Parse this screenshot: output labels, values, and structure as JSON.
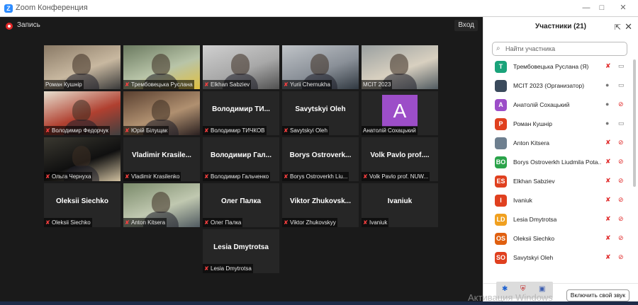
{
  "window": {
    "title": "Zoom Конференция",
    "controls": [
      "—",
      "□",
      "✕"
    ]
  },
  "stage": {
    "recording_label": "Запись",
    "exit_label": "Вход"
  },
  "tiles": [
    {
      "kind": "video",
      "label": "Роман Кушнір",
      "muted": false,
      "active": false
    },
    {
      "kind": "video",
      "label": "Трембовецька Руслана",
      "muted": true,
      "active": false
    },
    {
      "kind": "video",
      "label": "Elkhan Sabziev",
      "muted": true,
      "active": false
    },
    {
      "kind": "video",
      "label": "Yurii Chernukha",
      "muted": true,
      "active": false
    },
    {
      "kind": "video",
      "label": "MCIT 2023",
      "muted": false,
      "active": true
    },
    {
      "kind": "video",
      "label": "Володимир Федорчук",
      "muted": true,
      "active": false
    },
    {
      "kind": "video",
      "label": "Юрій Білущак",
      "muted": true,
      "active": false
    },
    {
      "kind": "name",
      "name": "Володимир ТИ...",
      "label": "Володимир ТИЧКОВ",
      "muted": true,
      "active": false
    },
    {
      "kind": "name",
      "name": "Savytskyi Oleh",
      "label": "Savytskyi Oleh",
      "muted": true,
      "active": false
    },
    {
      "kind": "avatar",
      "initial": "A",
      "label": "Анатолій Сохацький",
      "muted": false,
      "active": false
    },
    {
      "kind": "video",
      "label": "Ольга Чернуха",
      "muted": true,
      "active": false
    },
    {
      "kind": "name",
      "name": "Vladimir Krasile...",
      "label": "Vladimir Krasilenko",
      "muted": true,
      "active": false
    },
    {
      "kind": "name",
      "name": "Володимир Гал...",
      "label": "Володимир Гальченко",
      "muted": true,
      "active": false
    },
    {
      "kind": "name",
      "name": "Borys Ostroverk...",
      "label": "Borys Ostroverkh Liu...",
      "muted": true,
      "active": false
    },
    {
      "kind": "name",
      "name": "Volk Pavlo prof....",
      "label": "Volk Pavlo prof. NUW...",
      "muted": true,
      "active": false
    },
    {
      "kind": "name",
      "name": "Oleksii Siechko",
      "label": "Oleksii Siechko",
      "muted": true,
      "active": false
    },
    {
      "kind": "video",
      "label": "Anton Kitsera",
      "muted": true,
      "active": false
    },
    {
      "kind": "name",
      "name": "Олег Палка",
      "label": "Олег Палка",
      "muted": true,
      "active": false
    },
    {
      "kind": "name",
      "name": "Viktor Zhukovsk...",
      "label": "Viktor Zhukovskyy",
      "muted": true,
      "active": false
    },
    {
      "kind": "name",
      "name": "Ivaniuk",
      "label": "Ivaniuk",
      "muted": true,
      "active": false
    },
    {
      "kind": "name",
      "name": "Lesia Dmytrotsa",
      "label": "Lesia Dmytrotsa",
      "muted": true,
      "active": false
    }
  ],
  "sidebar": {
    "header": "Участники (21)",
    "search_placeholder": "Найти участника",
    "participants": [
      {
        "initials": "T",
        "color": "#1aa37a",
        "name": "Трембовецька Руслана (Я)",
        "mic": "muted",
        "cam": "on"
      },
      {
        "initials": "",
        "color": "#3a4a5c",
        "name": "MCIT 2023 (Организатор)",
        "mic": "on",
        "cam": "on"
      },
      {
        "initials": "A",
        "color": "#9c4ec8",
        "name": "Анатолій Сохацький",
        "mic": "on",
        "cam": "off"
      },
      {
        "initials": "P",
        "color": "#e0401f",
        "name": "Роман Кушнір",
        "mic": "on",
        "cam": "on"
      },
      {
        "initials": "",
        "color": "#6e7f8f",
        "name": "Anton Kitsera",
        "mic": "muted",
        "cam": "off"
      },
      {
        "initials": "BO",
        "color": "#2aa34a",
        "name": "Borys Ostroverkh Liudmila Pota...",
        "mic": "muted",
        "cam": "off"
      },
      {
        "initials": "ES",
        "color": "#e0401f",
        "name": "Elkhan Sabziev",
        "mic": "muted",
        "cam": "off"
      },
      {
        "initials": "I",
        "color": "#e0401f",
        "name": "Ivaniuk",
        "mic": "muted",
        "cam": "off"
      },
      {
        "initials": "LD",
        "color": "#f0a020",
        "name": "Lesia Dmytrotsa",
        "mic": "muted",
        "cam": "off"
      },
      {
        "initials": "OS",
        "color": "#e06010",
        "name": "Oleksii Siechko",
        "mic": "muted",
        "cam": "off"
      },
      {
        "initials": "SO",
        "color": "#e0401f",
        "name": "Savytskyi Oleh",
        "mic": "muted",
        "cam": "off"
      }
    ],
    "unmute_label": "Включить свой звук"
  },
  "watermark": "Активация Windows",
  "colors": {
    "accent": "#2d8cff",
    "muted_red": "#ff4040",
    "active_border": "#d6d95a"
  }
}
